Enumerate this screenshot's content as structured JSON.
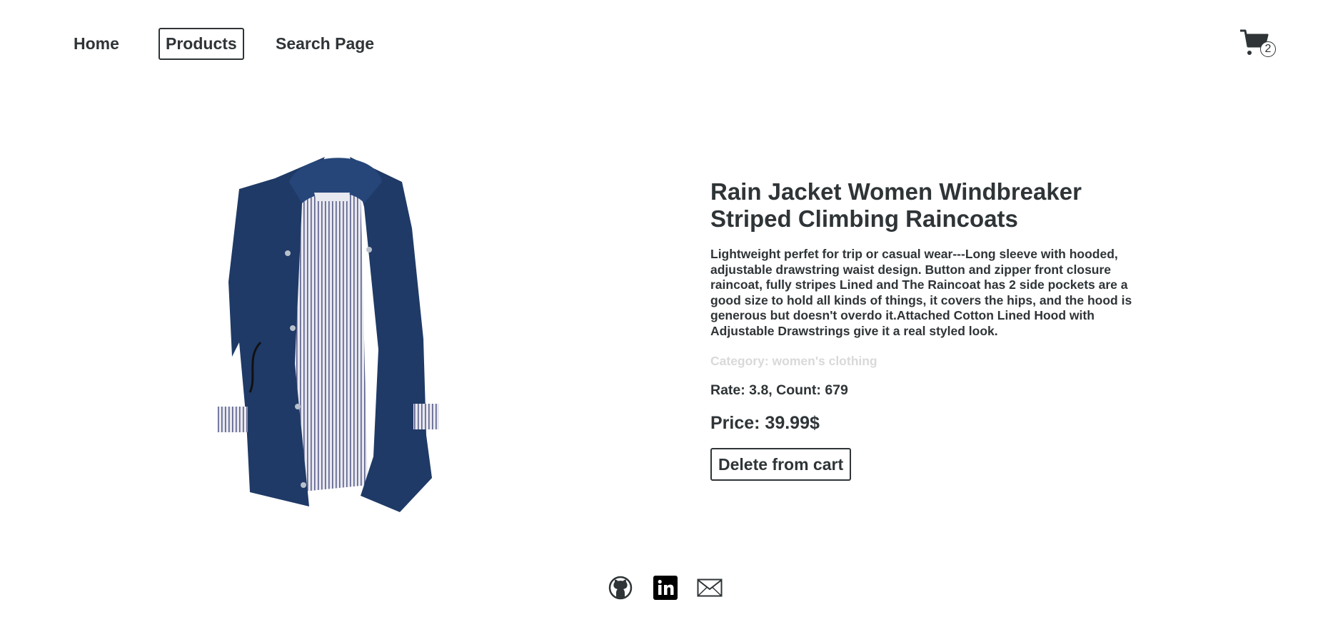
{
  "nav": {
    "home_label": "Home",
    "products_label": "Products",
    "search_label": "Search Page"
  },
  "cart": {
    "icon": "cart-icon",
    "count": "2"
  },
  "product": {
    "title": "Rain Jacket Women Windbreaker Striped Climbing Raincoats",
    "description": "Lightweight perfet for trip or casual wear---Long sleeve with hooded, adjustable drawstring waist design. Button and zipper front closure raincoat, fully stripes Lined and The Raincoat has 2 side pockets are a good size to hold all kinds of things, it covers the hips, and the hood is generous but doesn't overdo it.Attached Cotton Lined Hood with Adjustable Drawstrings give it a real styled look.",
    "category": "Category: women's clothing",
    "rating": "Rate: 3.8, Count: 679",
    "price": "Price: 39.99$",
    "delete_label": "Delete from cart",
    "image": "navy-rain-jacket-image"
  },
  "footer": {
    "icons": [
      "github-icon",
      "linkedin-icon",
      "mail-icon"
    ]
  },
  "colors": {
    "text": "#2f3437",
    "muted": "#d9d9d9",
    "jacket": "#1f3a66"
  }
}
